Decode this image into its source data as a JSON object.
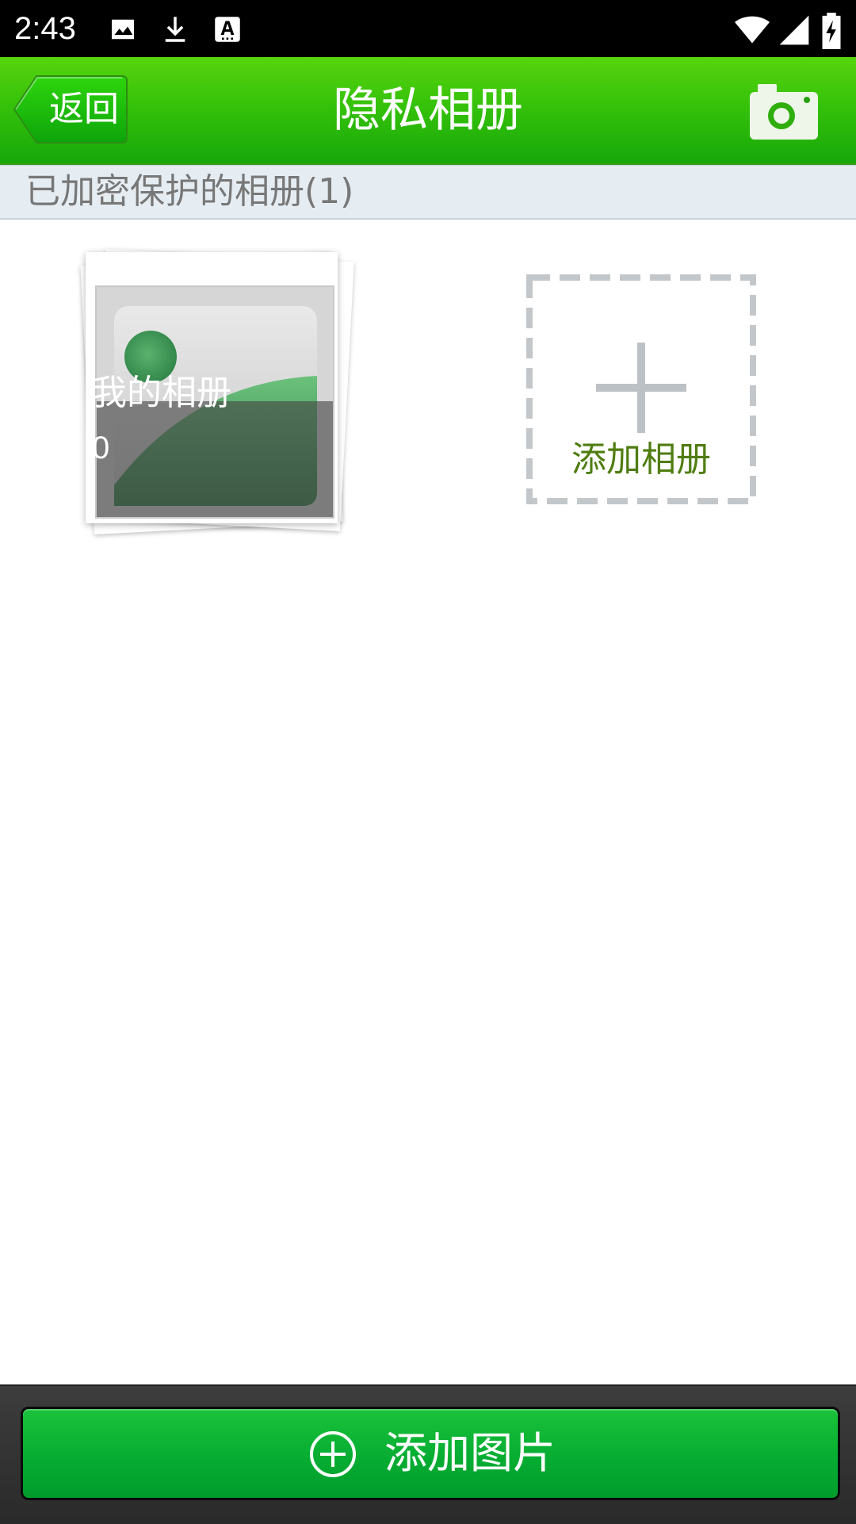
{
  "status_bar": {
    "time": "2:43",
    "left_icons": [
      "image-icon",
      "download-icon",
      "font-icon"
    ],
    "right_icons": [
      "wifi-icon",
      "signal-icon",
      "battery-charging-icon"
    ]
  },
  "header": {
    "back_label": "返回",
    "title": "隐私相册",
    "camera_icon": "camera-icon",
    "background_color": "#36c20a"
  },
  "section": {
    "title": "已加密保护的相册(1)"
  },
  "albums": [
    {
      "name": "我的相册",
      "count": "0"
    }
  ],
  "add_album": {
    "label": "添加相册",
    "icon": "plus-icon",
    "label_color": "#4f7d10"
  },
  "bottom": {
    "add_image_label": "添加图片",
    "icon": "add-circle-icon",
    "button_color": "#06ad32"
  }
}
